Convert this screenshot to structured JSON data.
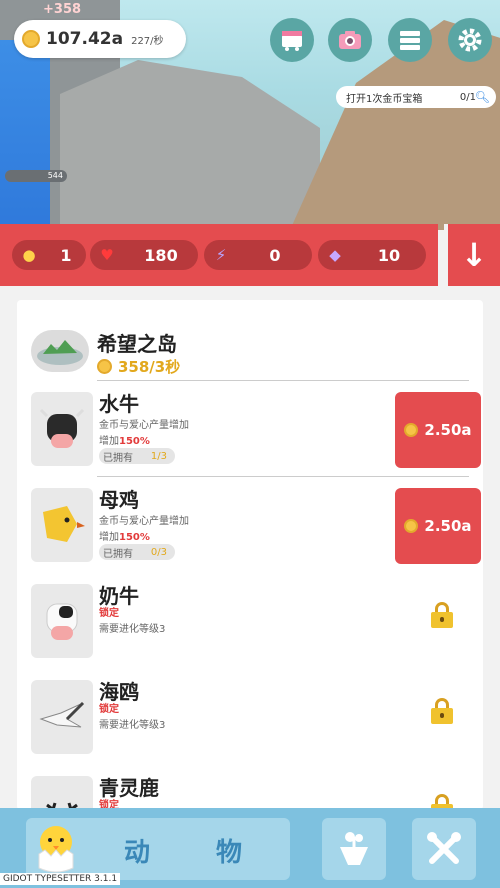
{
  "hud": {
    "floating_gain": "+358",
    "gold_amount": "107.42a",
    "gold_rate": "227/秒",
    "quest_text": "打开1次金币宝箱",
    "quest_progress": "0/1",
    "level_value": "544",
    "buttons": [
      "shop-cart-icon",
      "camera-icon",
      "menu-icon",
      "gear-icon"
    ]
  },
  "stats": {
    "chicks": "1",
    "hearts": "180",
    "energy": "0",
    "gems": "10"
  },
  "island": {
    "name": "希望之岛",
    "rate": "358/3秒"
  },
  "animals": [
    {
      "name": "水牛",
      "desc": "金币与爱心产量增加",
      "bonus_prefix": "增加",
      "bonus": "150%",
      "owned_label": "已拥有",
      "owned_count": "1/3",
      "price": "2.50a",
      "icon": "buffalo-icon"
    },
    {
      "name": "母鸡",
      "desc": "金币与爱心产量增加",
      "bonus_prefix": "增加",
      "bonus": "150%",
      "owned_label": "已拥有",
      "owned_count": "0/3",
      "price": "2.50a",
      "icon": "hen-icon"
    },
    {
      "name": "奶牛",
      "locked": "锁定",
      "requirement": "需要进化等级3",
      "icon": "cow-icon"
    },
    {
      "name": "海鸥",
      "locked": "锁定",
      "requirement": "需要进化等级3",
      "icon": "seagull-icon"
    },
    {
      "name": "青灵鹿",
      "locked": "锁定",
      "icon": "deer-icon"
    }
  ],
  "bottom_nav": {
    "tab_label_1": "动",
    "tab_label_2": "物"
  },
  "version": "GIDOT TYPESETTER 3.1.1",
  "colors": {
    "accent_red": "#e44c4f",
    "dark_red": "#b8393c",
    "gold": "#e2a81c",
    "nav_blue": "#7ec1df"
  }
}
